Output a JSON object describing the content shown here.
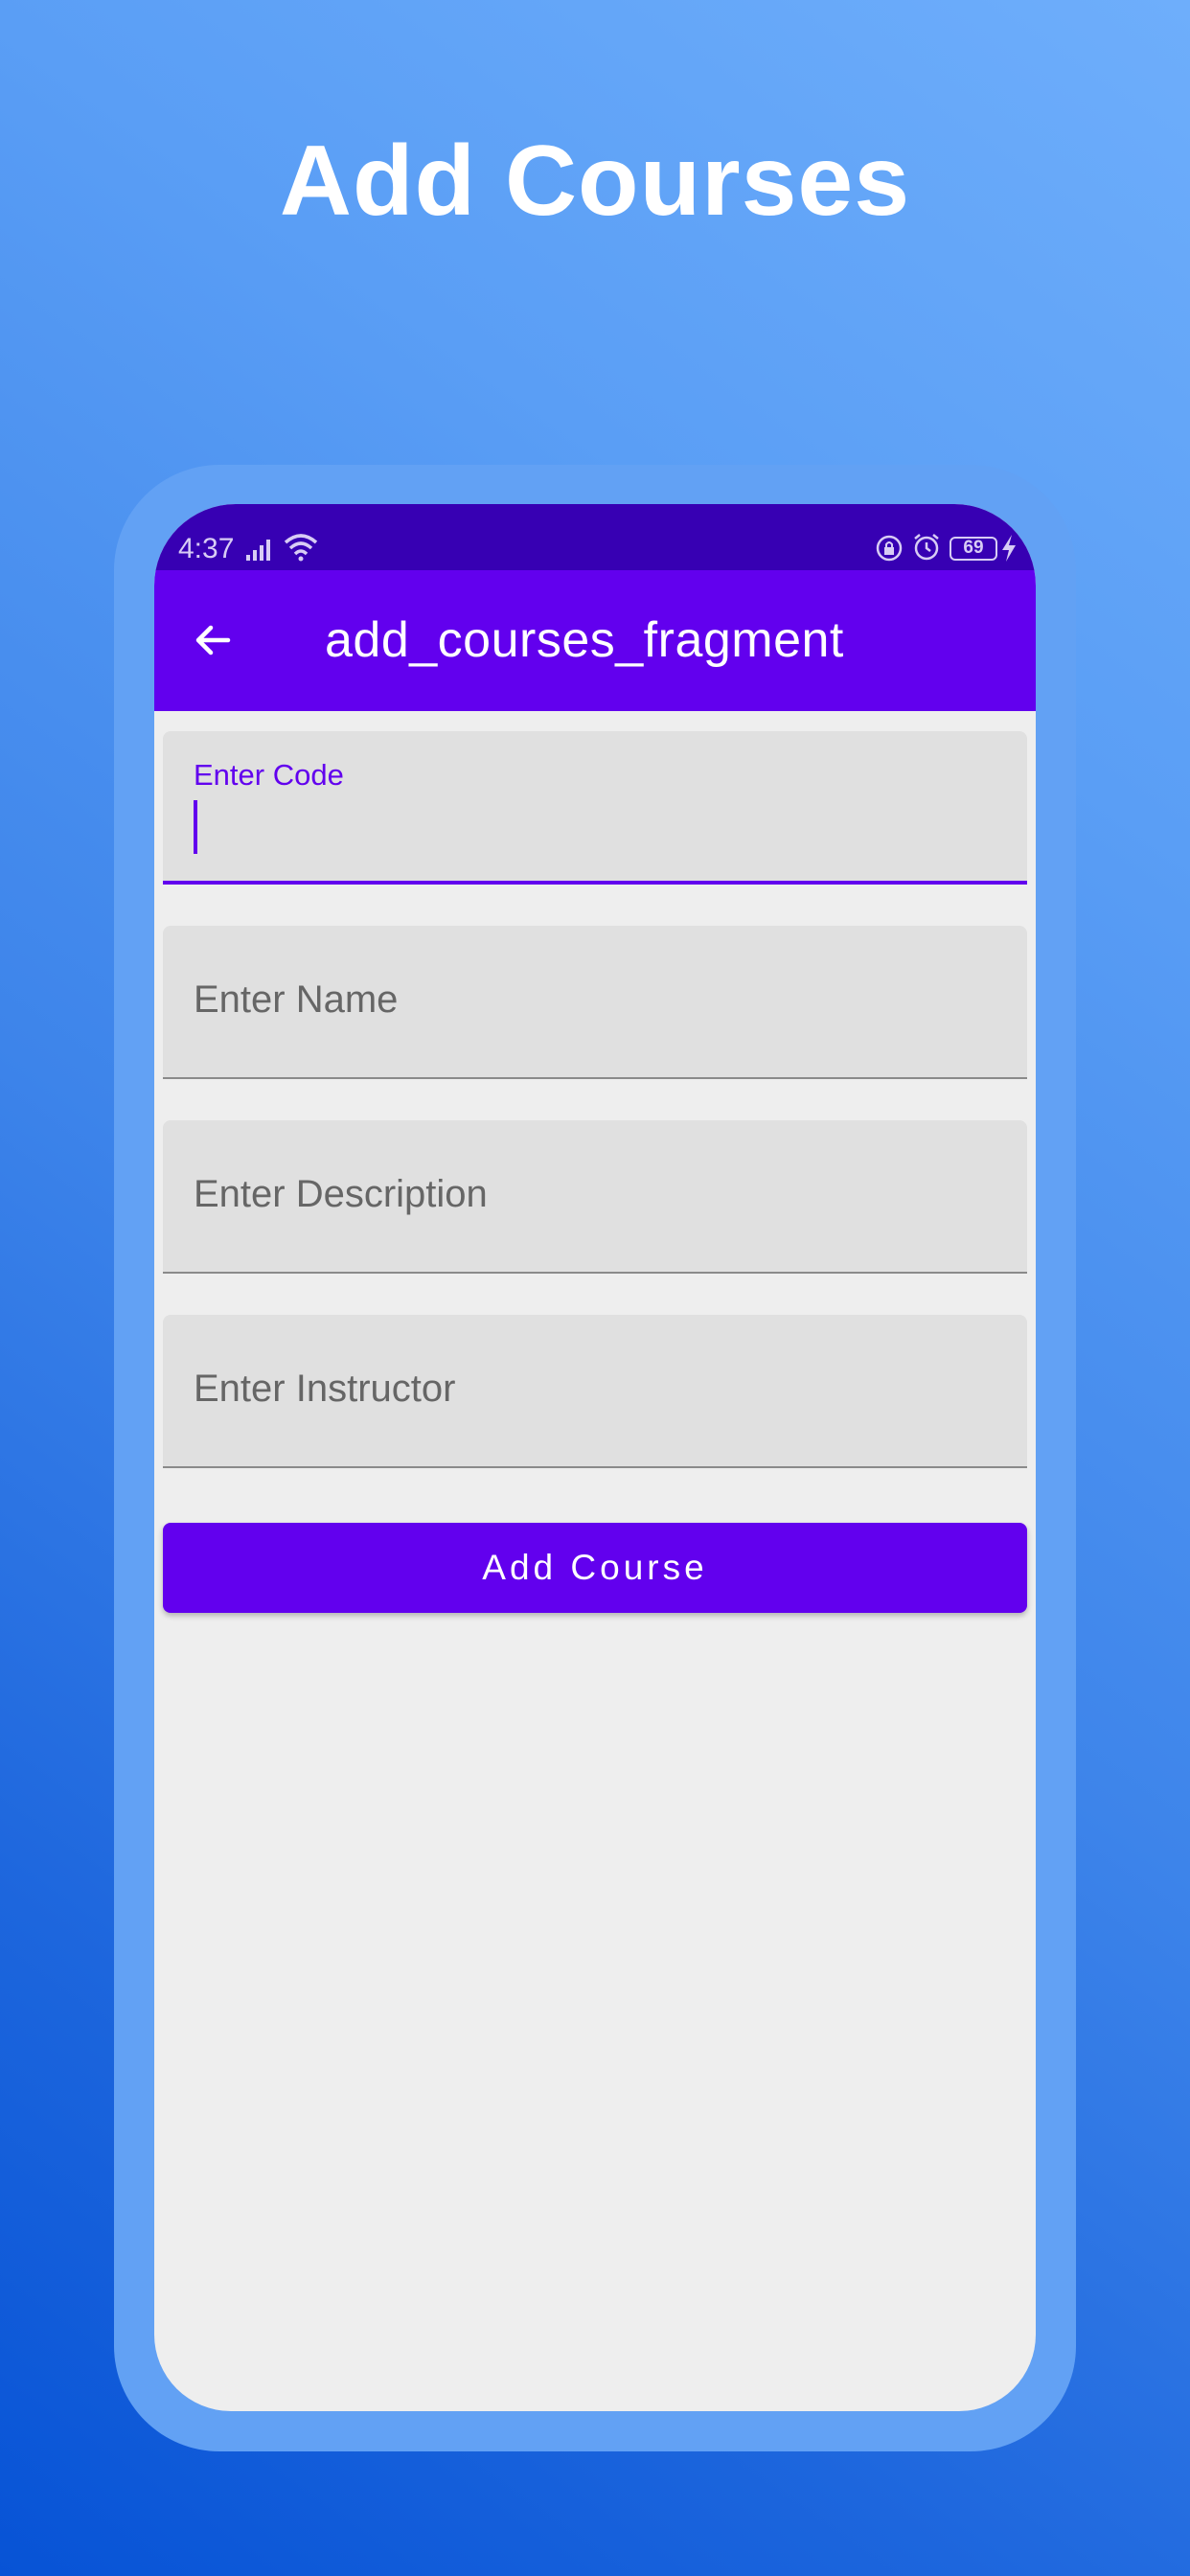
{
  "headline": "Add Courses",
  "status_bar": {
    "time": "4:37",
    "battery": "69",
    "icons": [
      "signal-icon",
      "wifi-icon",
      "lock-icon",
      "alarm-icon",
      "battery-icon",
      "charging-bolt-icon"
    ]
  },
  "app_bar": {
    "title": "add_courses_fragment",
    "back_icon": "arrow-back-icon"
  },
  "form": {
    "code": {
      "label": "Enter Code",
      "value": ""
    },
    "name": {
      "placeholder": "Enter Name"
    },
    "description": {
      "placeholder": "Enter Description"
    },
    "instructor": {
      "placeholder": "Enter Instructor"
    },
    "submit_label": "Add Course"
  },
  "colors": {
    "primary": "#6200ee",
    "primary_dark": "#3700b3",
    "background": "#eeeeee",
    "field_fill": "#e0e0e0"
  }
}
